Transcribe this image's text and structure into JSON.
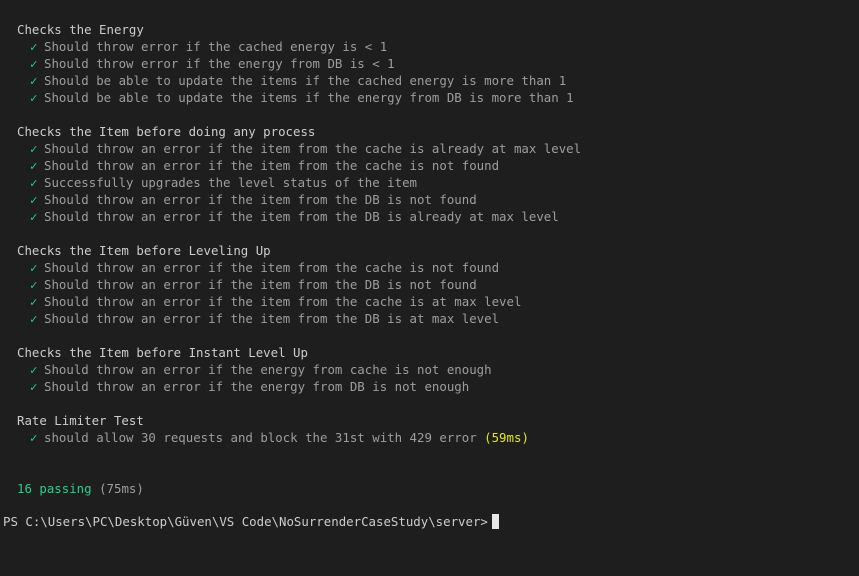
{
  "check_glyph": "✓",
  "suites": [
    {
      "title": "Checks the Energy",
      "tests": [
        "Should throw error if the cached energy is < 1",
        "Should throw error if the energy from DB is < 1",
        "Should be able to update the items if the cached energy is more than 1",
        "Should be able to update the items if the energy from DB is more than 1"
      ]
    },
    {
      "title": "Checks the Item before doing any process",
      "tests": [
        "Should throw an error if the item from the cache is already at max level",
        "Should throw an error if the item from the cache is not found",
        "Successfully upgrades the level status of the item",
        "Should throw an error if the item from the DB is not found",
        "Should throw an error if the item from the DB is already at max level"
      ]
    },
    {
      "title": "Checks the Item before Leveling Up",
      "tests": [
        "Should throw an error if the item from the cache is not found",
        "Should throw an error if the item from the DB is not found",
        "Should throw an error if the item from the cache is at max level",
        "Should throw an error if the item from the DB is at max level"
      ]
    },
    {
      "title": "Checks the Item before Instant Level Up",
      "tests": [
        "Should throw an error if the energy from cache is not enough",
        "Should throw an error if the energy from DB is not enough"
      ]
    },
    {
      "title": "Rate Limiter Test",
      "tests": [
        "should allow 30 requests and block the 31st with 429 error"
      ],
      "slow_duration": "(59ms)"
    }
  ],
  "summary": {
    "passing": "16 passing",
    "time": "(75ms)"
  },
  "prompt": "PS C:\\Users\\PC\\Desktop\\Güven\\VS Code\\NoSurrenderCaseStudy\\server>",
  "colors": {
    "background": "#1e1e1e",
    "pass": "#23d18b",
    "slow": "#e5e510",
    "text": "#cccccc",
    "dim": "#9d9d9d"
  }
}
